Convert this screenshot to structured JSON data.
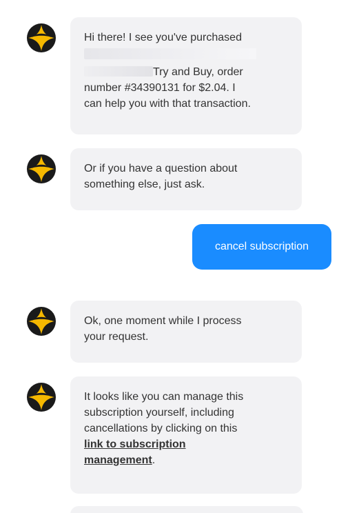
{
  "messages": {
    "m1": {
      "avatar_icon": "star-logo-icon",
      "line1": "Hi there! I see you've purchased",
      "line2_suffix": "Try and Buy, order",
      "line3": "number #34390131 for $2.04. I",
      "line4": "can help you with that transaction."
    },
    "m2": {
      "avatar_icon": "star-logo-icon",
      "line1": "Or if you have a question about",
      "line2": "something else, just ask."
    },
    "user": {
      "text": "cancel subscription"
    },
    "m3": {
      "avatar_icon": "star-logo-icon",
      "line1": "Ok, one moment while I process",
      "line2": "your request."
    },
    "m4": {
      "avatar_icon": "star-logo-icon",
      "line1": "It looks like you can manage this",
      "line2": "subscription yourself, including",
      "line3": "cancellations by clicking on this",
      "link_line1": "link to subscription",
      "link_line2": "management",
      "end": "."
    }
  },
  "colors": {
    "bot_bubble": "#f2f2f4",
    "user_bubble": "#1a8cff",
    "avatar_gold": "#f5b800",
    "avatar_dark": "#1a1a1a",
    "text": "#333333"
  }
}
